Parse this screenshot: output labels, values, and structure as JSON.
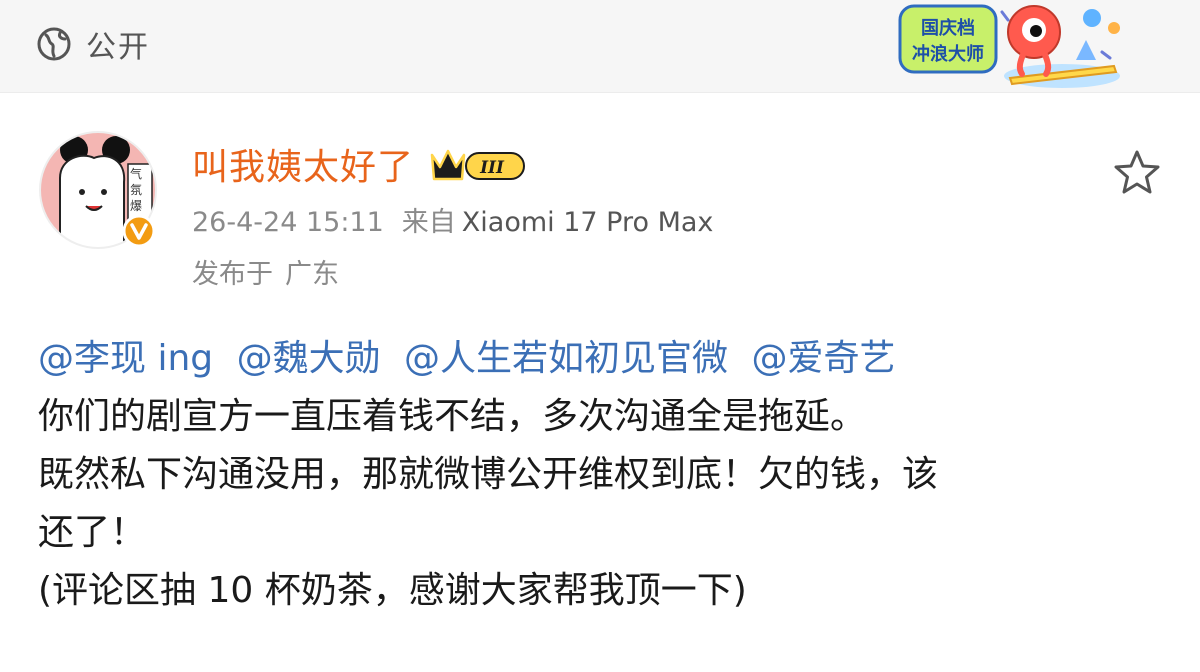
{
  "topbar": {
    "visibility_icon": "globe-icon",
    "visibility_label": "公开",
    "promo": {
      "line1": "国庆档",
      "line2": "冲浪大师"
    }
  },
  "post": {
    "author_name": "叫我姨太好了",
    "member_level": "III",
    "avatar_text": "气氛爆",
    "verified_icon": "verified-v-icon",
    "timestamp": "26-4-24 15:11",
    "source_prefix": "来自",
    "source_device": "Xiaomi 17 Pro Max",
    "location_prefix": "发布于",
    "location_value": "广东",
    "favorite_icon": "star-outline-icon",
    "mentions": [
      "@李现 ing",
      "@魏大勋",
      "@人生若如初见官微",
      "@爱奇艺"
    ],
    "text_lines": [
      "你们的剧宣方一直压着钱不结，多次沟通全是拖延。",
      "既然私下沟通没用，那就微博公开维权到底！欠的钱，该",
      "还了！",
      "(评论区抽 10 杯奶茶，感谢大家帮我顶一下)"
    ]
  },
  "colors": {
    "author": "#e8641b",
    "mention": "#3b6fb6",
    "meta": "#8a8a8a",
    "verified": "#f39c12"
  }
}
